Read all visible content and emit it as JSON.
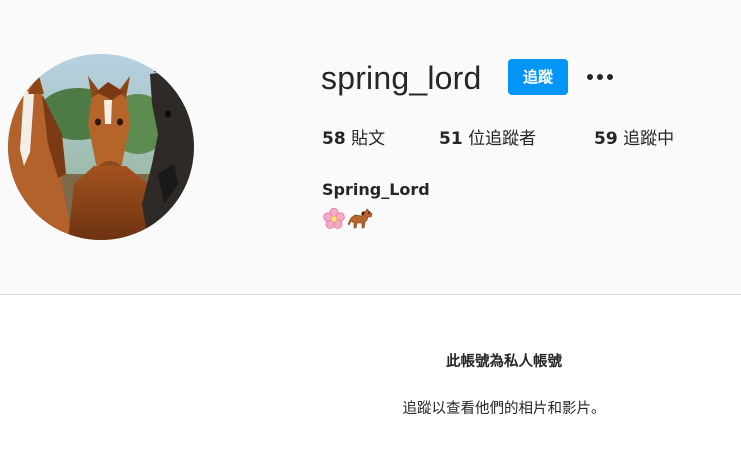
{
  "profile": {
    "username": "spring_lord",
    "follow_label": "追蹤",
    "more_options": "more-options-icon",
    "full_name": "Spring_Lord",
    "bio_icons": [
      "cherry-blossom-icon",
      "horse-icon"
    ]
  },
  "stats": {
    "posts_count": "58",
    "posts_label": " 貼文",
    "followers_count": "51",
    "followers_label": " 位追蹤者",
    "following_count": "59",
    "following_label": " 追蹤中"
  },
  "private_notice": {
    "title": "此帳號為私人帳號",
    "subtitle": "追蹤以查看他們的相片和影片。"
  },
  "colors": {
    "follow_button": "#0095f6",
    "header_background": "#fafafa",
    "divider": "#dbdbdb",
    "text": "#262626"
  }
}
